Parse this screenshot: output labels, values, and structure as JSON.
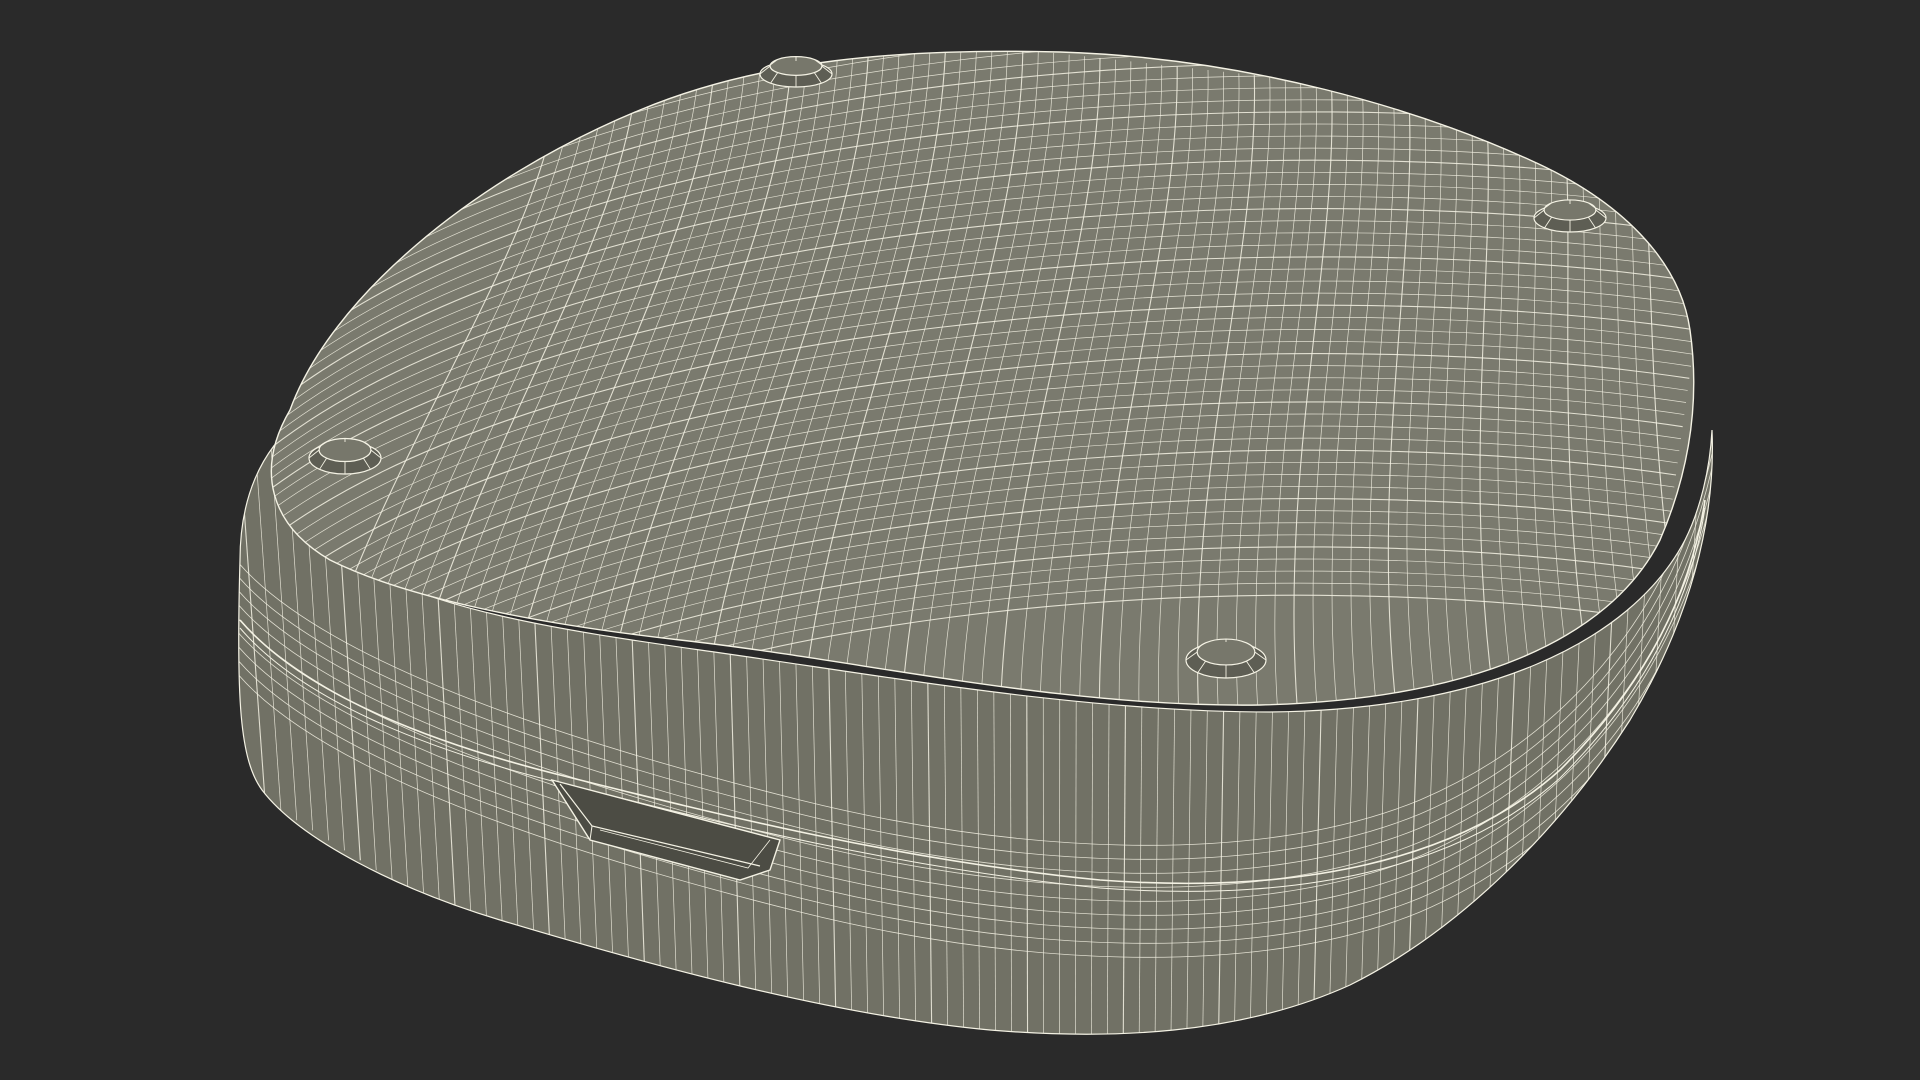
{
  "scene": {
    "subject": "wireframe-case-model",
    "background_color": "#2a2a2a",
    "surface_color": "#77776b",
    "surface_dark_color": "#5e5e54",
    "wire_color": "#f4f2e4",
    "slot_color": "#4a4a42",
    "bump_count": 4
  }
}
